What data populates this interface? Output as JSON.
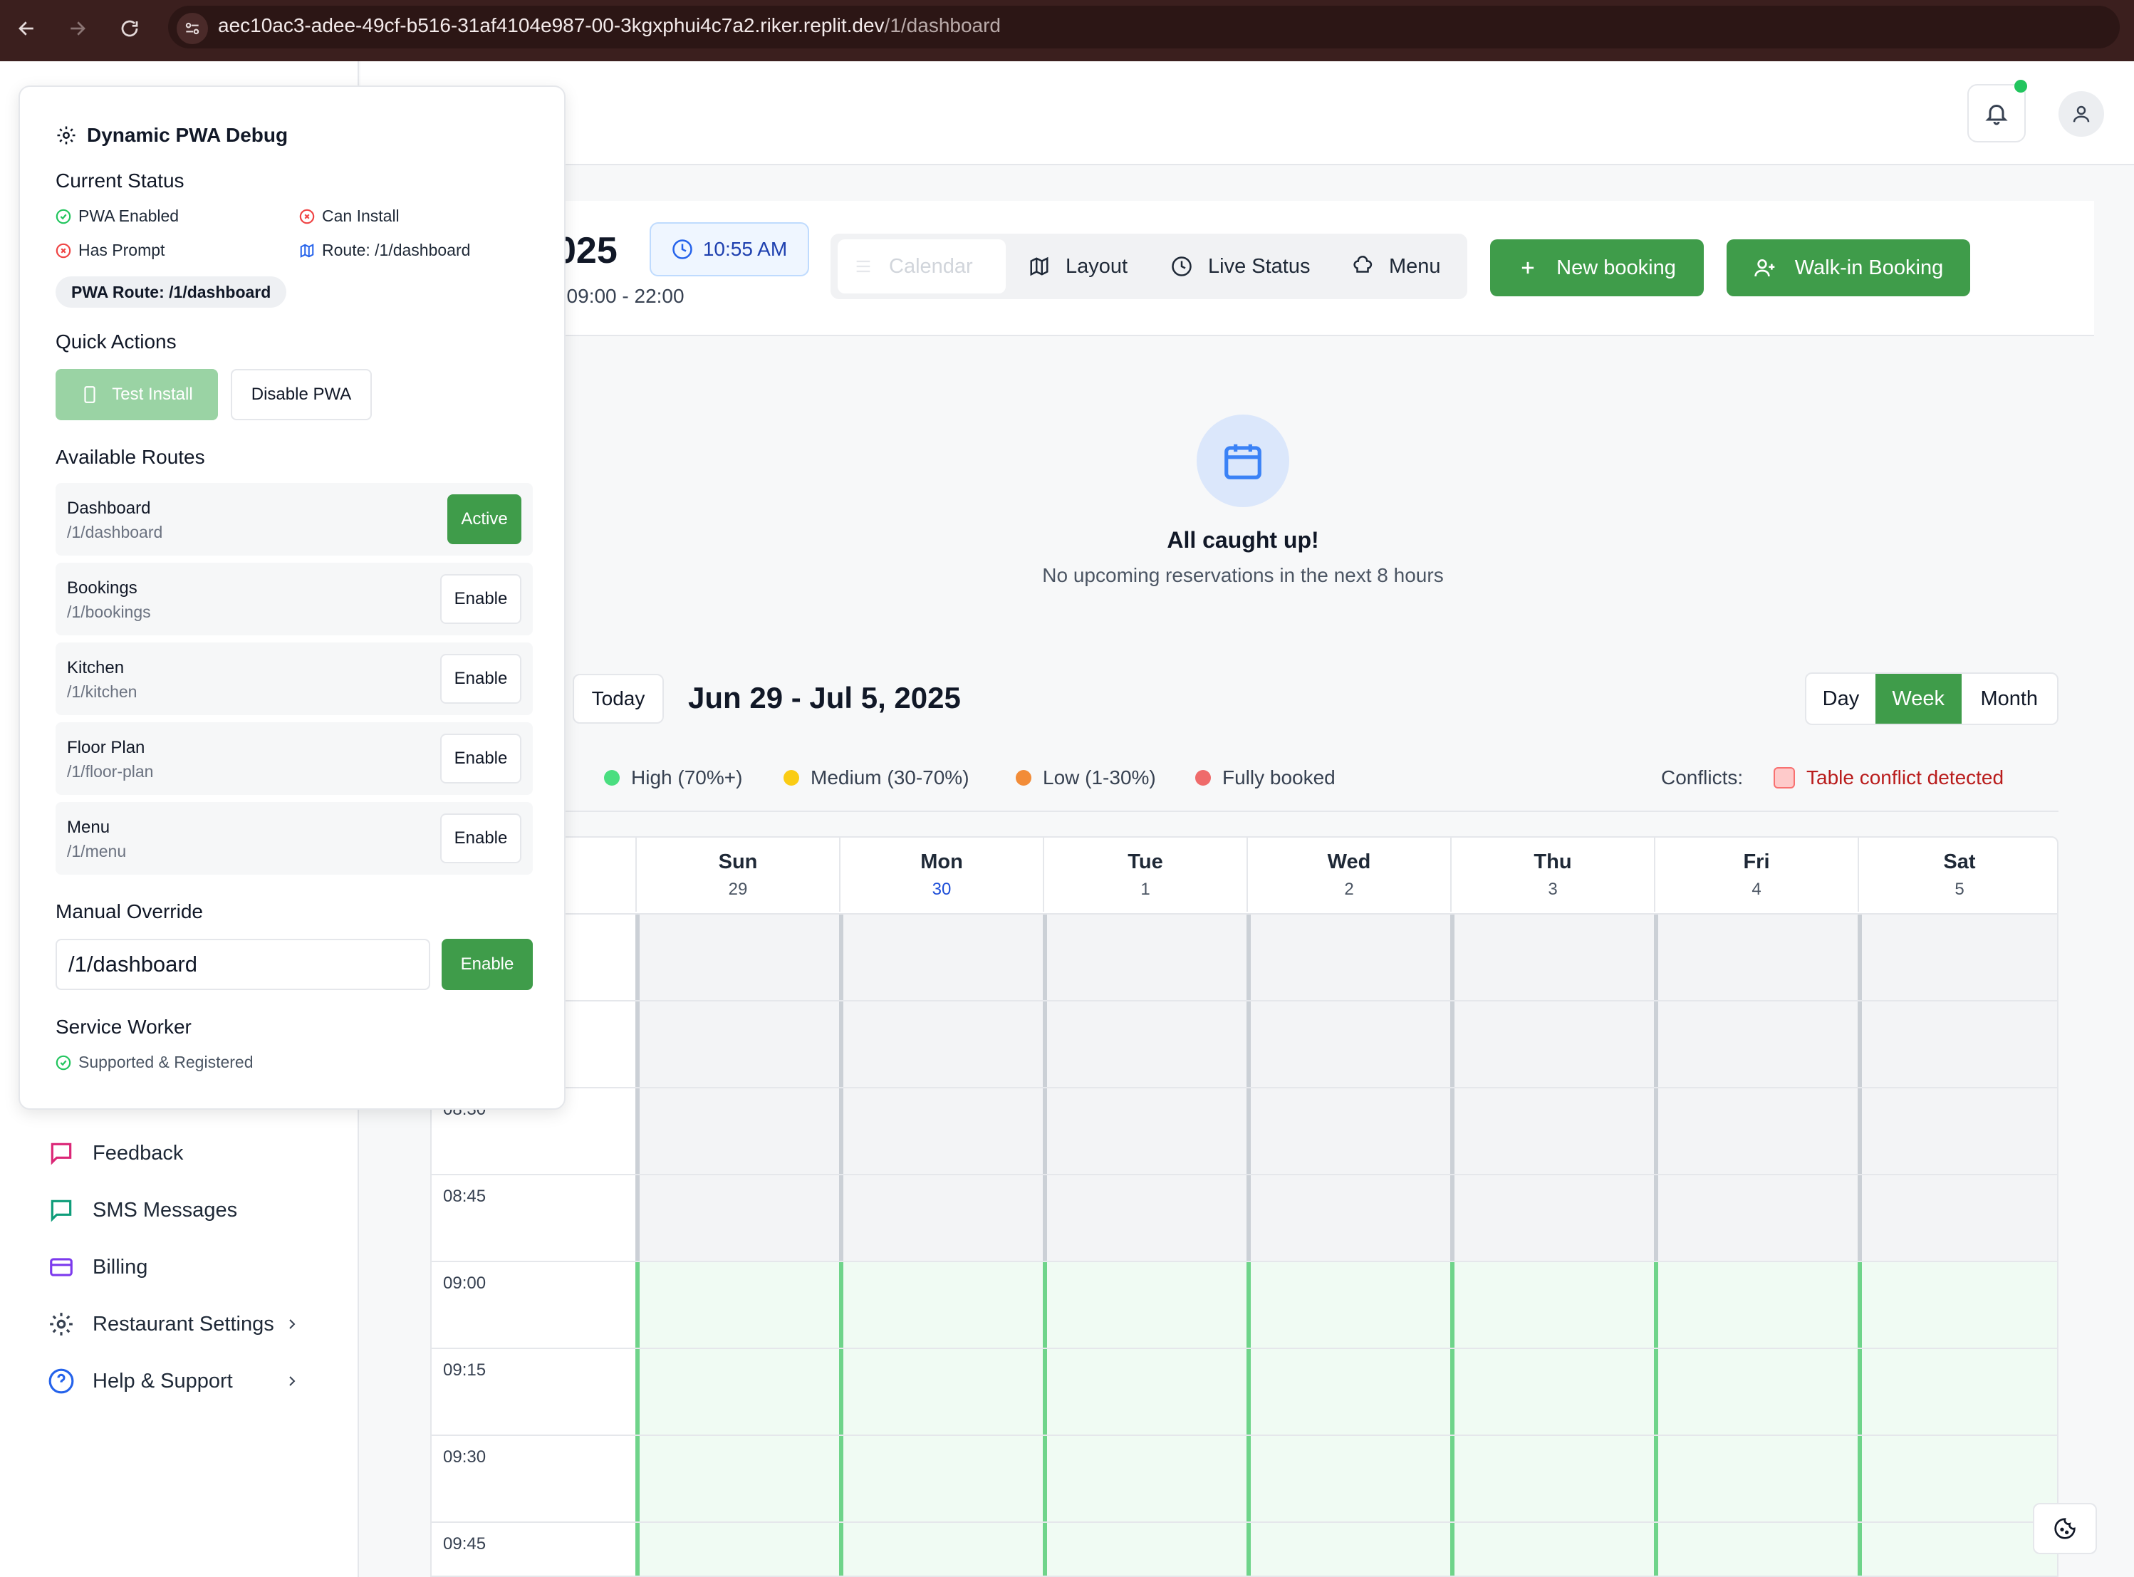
{
  "browser": {
    "url_host": "aec10ac3-adee-49cf-b516-31af4104e987-00-3kgxphui4c7a2.riker.replit.dev",
    "url_path": "/1/dashboard"
  },
  "sidebar": {
    "items": [
      {
        "label": "Feedback",
        "icon": "message-square-icon",
        "color": "#db2777"
      },
      {
        "label": "SMS Messages",
        "icon": "message-icon",
        "color": "#0f9d7a"
      },
      {
        "label": "Billing",
        "icon": "credit-card-icon",
        "color": "#7c3aed"
      },
      {
        "label": "Restaurant Settings",
        "icon": "gear-icon",
        "color": "#374151"
      },
      {
        "label": "Help & Support",
        "icon": "help-circle-icon",
        "color": "#2563eb"
      }
    ]
  },
  "header": {
    "date_partial": "025",
    "hours_partial": ": 09:00 - 22:00",
    "time": "10:55 AM",
    "tabs": [
      "Calendar",
      "Layout",
      "Live Status",
      "Menu"
    ],
    "new_booking": "New booking",
    "walk_in": "Walk-in Booking"
  },
  "empty_state": {
    "title": "All caught up!",
    "subtitle": "No upcoming reservations in the next 8 hours"
  },
  "calendar": {
    "today_label": "Today",
    "range": "Jun 29 - Jul 5, 2025",
    "views": [
      "Day",
      "Week",
      "Month"
    ],
    "active_view": "Week",
    "legend_prefix": ":",
    "legend": [
      {
        "label": "High (70%+)",
        "color": "#4ade80"
      },
      {
        "label": "Medium (30-70%)",
        "color": "#facc15"
      },
      {
        "label": "Low (1-30%)",
        "color": "#f28c38"
      },
      {
        "label": "Fully booked",
        "color": "#ef6b6b"
      }
    ],
    "conflicts_label": "Conflicts:",
    "conflict_text": "Table conflict detected",
    "days": [
      {
        "name": "Sun",
        "date": "29"
      },
      {
        "name": "Mon",
        "date": "30"
      },
      {
        "name": "Tue",
        "date": "1"
      },
      {
        "name": "Wed",
        "date": "2"
      },
      {
        "name": "Thu",
        "date": "3"
      },
      {
        "name": "Fri",
        "date": "4"
      },
      {
        "name": "Sat",
        "date": "5"
      }
    ],
    "today_date": "30",
    "time_slots": [
      "",
      "",
      "08:30",
      "08:45",
      "09:00",
      "09:15",
      "09:30",
      "09:45"
    ]
  },
  "debug": {
    "title": "Dynamic PWA Debug",
    "current_status": "Current Status",
    "status": {
      "pwa_enabled": "PWA Enabled",
      "can_install": "Can Install",
      "has_prompt": "Has Prompt",
      "route": "Route: /1/dashboard"
    },
    "pwa_route": "PWA Route: /1/dashboard",
    "quick_actions": "Quick Actions",
    "test_install": "Test Install",
    "disable_pwa": "Disable PWA",
    "available_routes": "Available Routes",
    "routes": [
      {
        "name": "Dashboard",
        "path": "/1/dashboard",
        "action": "Active"
      },
      {
        "name": "Bookings",
        "path": "/1/bookings",
        "action": "Enable"
      },
      {
        "name": "Kitchen",
        "path": "/1/kitchen",
        "action": "Enable"
      },
      {
        "name": "Floor Plan",
        "path": "/1/floor-plan",
        "action": "Enable"
      },
      {
        "name": "Menu",
        "path": "/1/menu",
        "action": "Enable"
      }
    ],
    "manual_override": "Manual Override",
    "override_value": "/1/dashboard",
    "override_button": "Enable",
    "service_worker": "Service Worker",
    "sw_status": "Supported & Registered"
  }
}
